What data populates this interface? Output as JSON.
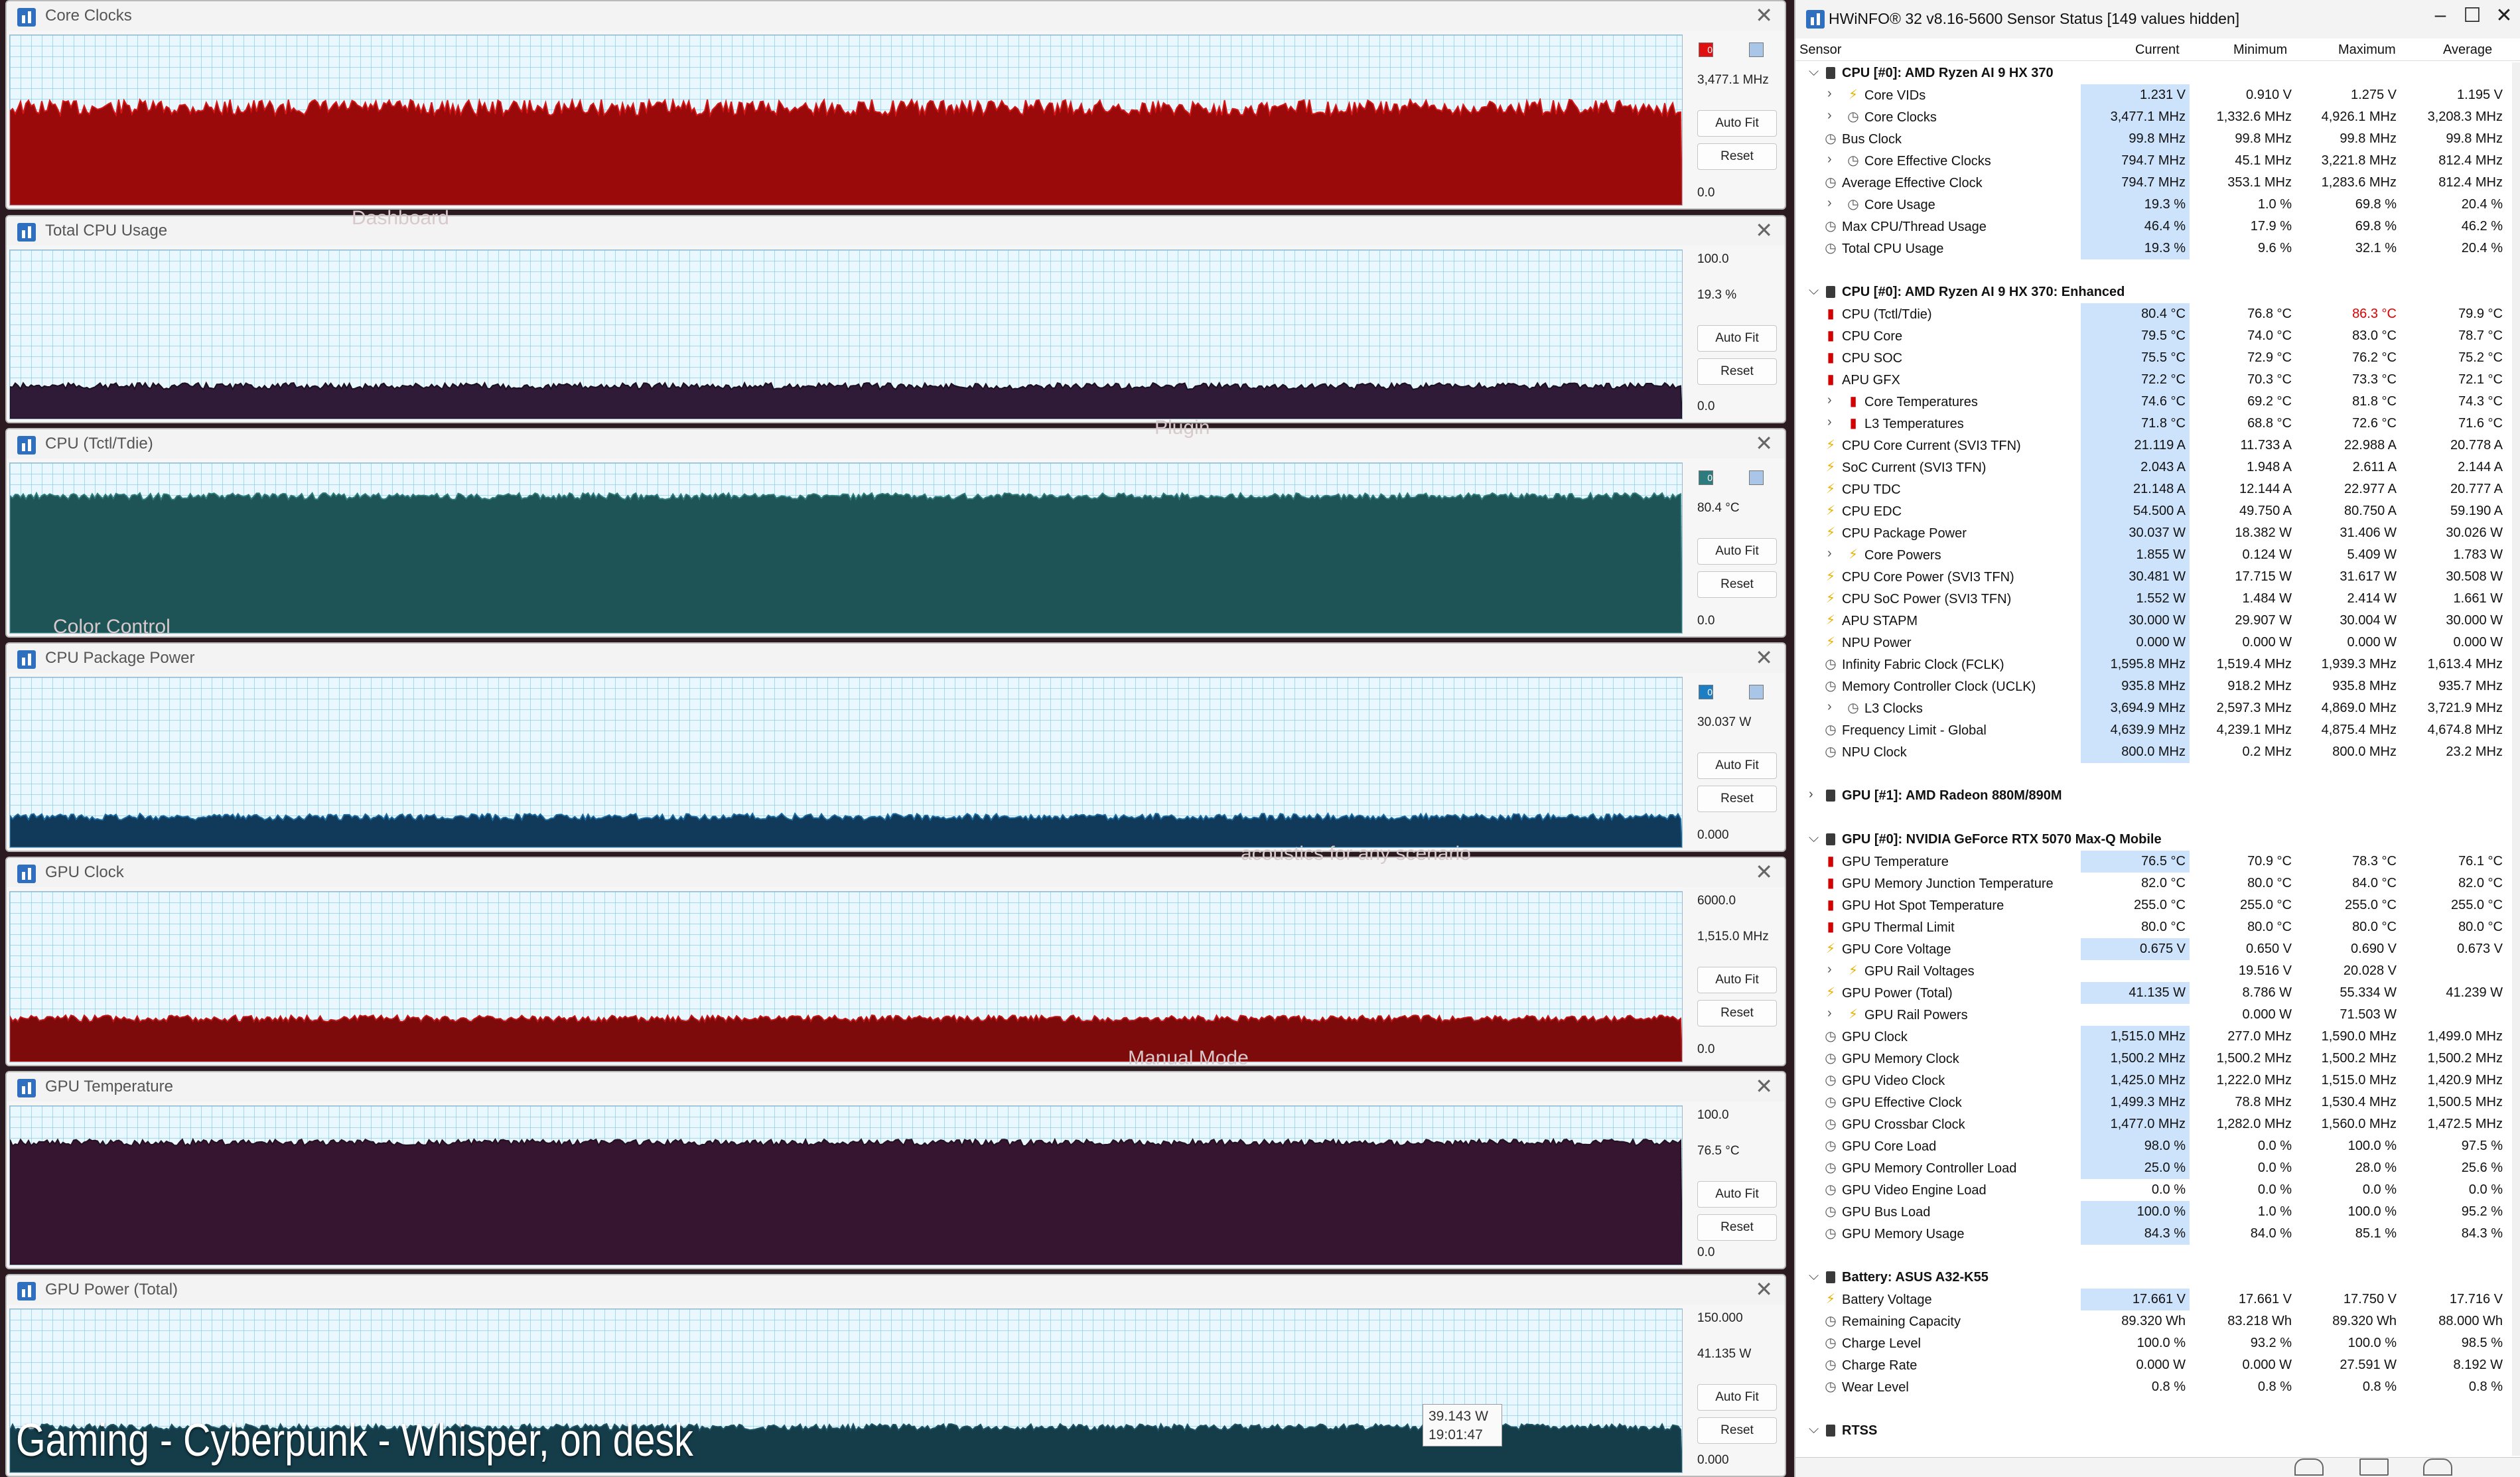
{
  "graphs": [
    {
      "title": "Core Clocks",
      "max": "",
      "current": "3,477.1 MHz",
      "min": "0.0",
      "level": 0.57,
      "fill": "#9b0a0a",
      "edge": "#d41818",
      "swatch": "#e01010",
      "swatch_text": "0",
      "auto_fit": "Auto Fit",
      "reset": "Reset"
    },
    {
      "title": "Total CPU Usage",
      "max": "100.0",
      "current": "19.3 %",
      "min": "0.0",
      "level": 0.193,
      "fill": "#2f1b37",
      "edge": "#1b0f20",
      "swatch": "",
      "swatch_text": "",
      "auto_fit": "Auto Fit",
      "reset": "Reset"
    },
    {
      "title": "CPU (Tctl/Tdie)",
      "max": "",
      "current": "80.4 °C",
      "min": "0.0",
      "level": 0.8,
      "fill": "#1f5457",
      "edge": "#2f7b7c",
      "swatch": "#2e7b7d",
      "swatch_text": "0",
      "auto_fit": "Auto Fit",
      "reset": "Reset"
    },
    {
      "title": "CPU Package Power",
      "max": "",
      "current": "30.037 W",
      "min": "0.000",
      "level": 0.18,
      "fill": "#10395a",
      "edge": "#1a6aa0",
      "swatch": "#1d7ec4",
      "swatch_text": "0",
      "auto_fit": "Auto Fit",
      "reset": "Reset"
    },
    {
      "title": "GPU Clock",
      "max": "6000.0",
      "current": "1,515.0 MHz",
      "min": "0.0",
      "level": 0.2525,
      "fill": "#7d0b0b",
      "edge": "#c41515",
      "swatch": "",
      "swatch_text": "",
      "auto_fit": "Auto Fit",
      "reset": "Reset"
    },
    {
      "title": "GPU Temperature",
      "max": "100.0",
      "current": "76.5 °C",
      "min": "0.0",
      "level": 0.765,
      "fill": "#35152f",
      "edge": "#231020",
      "swatch": "",
      "swatch_text": "",
      "auto_fit": "Auto Fit",
      "reset": "Reset"
    },
    {
      "title": "GPU Power (Total)",
      "max": "150.000",
      "current": "41.135 W",
      "min": "0.000",
      "level": 0.274,
      "fill": "#143c49",
      "edge": "#1d5566",
      "swatch": "",
      "swatch_text": "",
      "auto_fit": "Auto Fit",
      "reset": "Reset"
    }
  ],
  "caption": "Gaming - Cyberpunk - Whisper, on desk",
  "tooltip": {
    "value": "39.143 W",
    "time": "19:01:47"
  },
  "bg_words": [
    "Dashboard",
    "Plugin",
    "Color Control",
    "acoustics for any scenario",
    "Manual Mode"
  ],
  "sensor": {
    "title": "HWiNFO® 32 v8.16-5600 Sensor Status [149 values hidden]",
    "columns": {
      "sensor": "Sensor",
      "current": "Current",
      "minimum": "Minimum",
      "maximum": "Maximum",
      "average": "Average"
    },
    "rows": [
      {
        "type": "group",
        "expanded": true,
        "name": "CPU [#0]: AMD Ryzen AI 9 HX 370"
      },
      {
        "icon": "bolt",
        "indent": 1,
        "exp": true,
        "label": "Core VIDs",
        "cur": "1.231 V",
        "min": "0.910 V",
        "max": "1.275 V",
        "avg": "1.195 V",
        "hl": true
      },
      {
        "icon": "clock",
        "indent": 1,
        "exp": true,
        "label": "Core Clocks",
        "cur": "3,477.1 MHz",
        "min": "1,332.6 MHz",
        "max": "4,926.1 MHz",
        "avg": "3,208.3 MHz",
        "hl": true
      },
      {
        "icon": "clock",
        "indent": 0,
        "label": "Bus Clock",
        "cur": "99.8 MHz",
        "min": "99.8 MHz",
        "max": "99.8 MHz",
        "avg": "99.8 MHz",
        "hl": true
      },
      {
        "icon": "clock",
        "indent": 1,
        "exp": true,
        "label": "Core Effective Clocks",
        "cur": "794.7 MHz",
        "min": "45.1 MHz",
        "max": "3,221.8 MHz",
        "avg": "812.4 MHz",
        "hl": true
      },
      {
        "icon": "clock",
        "indent": 0,
        "label": "Average Effective Clock",
        "cur": "794.7 MHz",
        "min": "353.1 MHz",
        "max": "1,283.6 MHz",
        "avg": "812.4 MHz",
        "hl": true
      },
      {
        "icon": "clock",
        "indent": 1,
        "exp": true,
        "label": "Core Usage",
        "cur": "19.3 %",
        "min": "1.0 %",
        "max": "69.8 %",
        "avg": "20.4 %",
        "hl": true
      },
      {
        "icon": "clock",
        "indent": 0,
        "label": "Max CPU/Thread Usage",
        "cur": "46.4 %",
        "min": "17.9 %",
        "max": "69.8 %",
        "avg": "46.2 %",
        "hl": true
      },
      {
        "icon": "clock",
        "indent": 0,
        "label": "Total CPU Usage",
        "cur": "19.3 %",
        "min": "9.6 %",
        "max": "32.1 %",
        "avg": "20.4 %",
        "hl": true
      },
      {
        "type": "spacer"
      },
      {
        "type": "group",
        "expanded": true,
        "name": "CPU [#0]: AMD Ryzen AI 9 HX 370: Enhanced"
      },
      {
        "icon": "therm",
        "indent": 0,
        "label": "CPU (Tctl/Tdie)",
        "cur": "80.4 °C",
        "min": "76.8 °C",
        "max": "86.3 °C",
        "avg": "79.9 °C",
        "hl": true,
        "maxred": true
      },
      {
        "icon": "therm",
        "indent": 0,
        "label": "CPU Core",
        "cur": "79.5 °C",
        "min": "74.0 °C",
        "max": "83.0 °C",
        "avg": "78.7 °C",
        "hl": true
      },
      {
        "icon": "therm",
        "indent": 0,
        "label": "CPU SOC",
        "cur": "75.5 °C",
        "min": "72.9 °C",
        "max": "76.2 °C",
        "avg": "75.2 °C",
        "hl": true
      },
      {
        "icon": "therm",
        "indent": 0,
        "label": "APU GFX",
        "cur": "72.2 °C",
        "min": "70.3 °C",
        "max": "73.3 °C",
        "avg": "72.1 °C",
        "hl": true
      },
      {
        "icon": "therm",
        "indent": 1,
        "exp": true,
        "label": "Core Temperatures",
        "cur": "74.6 °C",
        "min": "69.2 °C",
        "max": "81.8 °C",
        "avg": "74.3 °C",
        "hl": true
      },
      {
        "icon": "therm",
        "indent": 1,
        "exp": true,
        "label": "L3 Temperatures",
        "cur": "71.8 °C",
        "min": "68.8 °C",
        "max": "72.6 °C",
        "avg": "71.6 °C",
        "hl": true
      },
      {
        "icon": "bolt",
        "indent": 0,
        "label": "CPU Core Current (SVI3 TFN)",
        "cur": "21.119 A",
        "min": "11.733 A",
        "max": "22.988 A",
        "avg": "20.778 A",
        "hl": true
      },
      {
        "icon": "bolt",
        "indent": 0,
        "label": "SoC Current (SVI3 TFN)",
        "cur": "2.043 A",
        "min": "1.948 A",
        "max": "2.611 A",
        "avg": "2.144 A",
        "hl": true
      },
      {
        "icon": "bolt",
        "indent": 0,
        "label": "CPU TDC",
        "cur": "21.148 A",
        "min": "12.144 A",
        "max": "22.977 A",
        "avg": "20.777 A",
        "hl": true
      },
      {
        "icon": "bolt",
        "indent": 0,
        "label": "CPU EDC",
        "cur": "54.500 A",
        "min": "49.750 A",
        "max": "80.750 A",
        "avg": "59.190 A",
        "hl": true
      },
      {
        "icon": "bolt",
        "indent": 0,
        "label": "CPU Package Power",
        "cur": "30.037 W",
        "min": "18.382 W",
        "max": "31.406 W",
        "avg": "30.026 W",
        "hl": true
      },
      {
        "icon": "bolt",
        "indent": 1,
        "exp": true,
        "label": "Core Powers",
        "cur": "1.855 W",
        "min": "0.124 W",
        "max": "5.409 W",
        "avg": "1.783 W",
        "hl": true
      },
      {
        "icon": "bolt",
        "indent": 0,
        "label": "CPU Core Power (SVI3 TFN)",
        "cur": "30.481 W",
        "min": "17.715 W",
        "max": "31.617 W",
        "avg": "30.508 W",
        "hl": true
      },
      {
        "icon": "bolt",
        "indent": 0,
        "label": "CPU SoC Power (SVI3 TFN)",
        "cur": "1.552 W",
        "min": "1.484 W",
        "max": "2.414 W",
        "avg": "1.661 W",
        "hl": true
      },
      {
        "icon": "bolt",
        "indent": 0,
        "label": "APU STAPM",
        "cur": "30.000 W",
        "min": "29.907 W",
        "max": "30.004 W",
        "avg": "30.000 W",
        "hl": true
      },
      {
        "icon": "bolt",
        "indent": 0,
        "label": "NPU Power",
        "cur": "0.000 W",
        "min": "0.000 W",
        "max": "0.000 W",
        "avg": "0.000 W",
        "hl": true
      },
      {
        "icon": "clock",
        "indent": 0,
        "label": "Infinity Fabric Clock (FCLK)",
        "cur": "1,595.8 MHz",
        "min": "1,519.4 MHz",
        "max": "1,939.3 MHz",
        "avg": "1,613.4 MHz",
        "hl": true
      },
      {
        "icon": "clock",
        "indent": 0,
        "label": "Memory Controller Clock (UCLK)",
        "cur": "935.8 MHz",
        "min": "918.2 MHz",
        "max": "935.8 MHz",
        "avg": "935.7 MHz",
        "hl": true
      },
      {
        "icon": "clock",
        "indent": 1,
        "exp": true,
        "label": "L3 Clocks",
        "cur": "3,694.9 MHz",
        "min": "2,597.3 MHz",
        "max": "4,869.0 MHz",
        "avg": "3,721.9 MHz",
        "hl": true
      },
      {
        "icon": "clock",
        "indent": 0,
        "label": "Frequency Limit - Global",
        "cur": "4,639.9 MHz",
        "min": "4,239.1 MHz",
        "max": "4,875.4 MHz",
        "avg": "4,674.8 MHz",
        "hl": true
      },
      {
        "icon": "clock",
        "indent": 0,
        "label": "NPU Clock",
        "cur": "800.0 MHz",
        "min": "0.2 MHz",
        "max": "800.0 MHz",
        "avg": "23.2 MHz",
        "hl": true
      },
      {
        "type": "spacer"
      },
      {
        "type": "group",
        "expanded": false,
        "name": "GPU [#1]: AMD Radeon 880M/890M"
      },
      {
        "type": "spacer"
      },
      {
        "type": "group",
        "expanded": true,
        "name": "GPU [#0]: NVIDIA  GeForce RTX 5070 Max-Q Mobile"
      },
      {
        "icon": "therm",
        "indent": 0,
        "label": "GPU Temperature",
        "cur": "76.5 °C",
        "min": "70.9 °C",
        "max": "78.3 °C",
        "avg": "76.1 °C",
        "hl": true
      },
      {
        "icon": "therm",
        "indent": 0,
        "label": "GPU Memory Junction Temperature",
        "cur": "82.0 °C",
        "min": "80.0 °C",
        "max": "84.0 °C",
        "avg": "82.0 °C",
        "hl": false
      },
      {
        "icon": "therm",
        "indent": 0,
        "label": "GPU Hot Spot Temperature",
        "cur": "255.0 °C",
        "min": "255.0 °C",
        "max": "255.0 °C",
        "avg": "255.0 °C",
        "hl": false
      },
      {
        "icon": "therm",
        "indent": 0,
        "label": "GPU Thermal Limit",
        "cur": "80.0 °C",
        "min": "80.0 °C",
        "max": "80.0 °C",
        "avg": "80.0 °C",
        "hl": false
      },
      {
        "icon": "bolt",
        "indent": 0,
        "label": "GPU Core Voltage",
        "cur": "0.675 V",
        "min": "0.650 V",
        "max": "0.690 V",
        "avg": "0.673 V",
        "hl": true
      },
      {
        "icon": "bolt",
        "indent": 1,
        "exp": true,
        "label": "GPU Rail Voltages",
        "cur": "",
        "min": "19.516 V",
        "max": "20.028 V",
        "avg": "",
        "hl": false
      },
      {
        "icon": "bolt",
        "indent": 0,
        "label": "GPU Power (Total)",
        "cur": "41.135 W",
        "min": "8.786 W",
        "max": "55.334 W",
        "avg": "41.239 W",
        "hl": true
      },
      {
        "icon": "bolt",
        "indent": 1,
        "exp": true,
        "label": "GPU Rail Powers",
        "cur": "",
        "min": "0.000 W",
        "max": "71.503 W",
        "avg": "",
        "hl": false
      },
      {
        "icon": "clock",
        "indent": 0,
        "label": "GPU Clock",
        "cur": "1,515.0 MHz",
        "min": "277.0 MHz",
        "max": "1,590.0 MHz",
        "avg": "1,499.0 MHz",
        "hl": true
      },
      {
        "icon": "clock",
        "indent": 0,
        "label": "GPU Memory Clock",
        "cur": "1,500.2 MHz",
        "min": "1,500.2 MHz",
        "max": "1,500.2 MHz",
        "avg": "1,500.2 MHz",
        "hl": true
      },
      {
        "icon": "clock",
        "indent": 0,
        "label": "GPU Video Clock",
        "cur": "1,425.0 MHz",
        "min": "1,222.0 MHz",
        "max": "1,515.0 MHz",
        "avg": "1,420.9 MHz",
        "hl": true
      },
      {
        "icon": "clock",
        "indent": 0,
        "label": "GPU Effective Clock",
        "cur": "1,499.3 MHz",
        "min": "78.8 MHz",
        "max": "1,530.4 MHz",
        "avg": "1,500.5 MHz",
        "hl": true
      },
      {
        "icon": "clock",
        "indent": 0,
        "label": "GPU Crossbar Clock",
        "cur": "1,477.0 MHz",
        "min": "1,282.0 MHz",
        "max": "1,560.0 MHz",
        "avg": "1,472.5 MHz",
        "hl": true
      },
      {
        "icon": "clock",
        "indent": 0,
        "label": "GPU Core Load",
        "cur": "98.0 %",
        "min": "0.0 %",
        "max": "100.0 %",
        "avg": "97.5 %",
        "hl": true
      },
      {
        "icon": "clock",
        "indent": 0,
        "label": "GPU Memory Controller Load",
        "cur": "25.0 %",
        "min": "0.0 %",
        "max": "28.0 %",
        "avg": "25.6 %",
        "hl": true
      },
      {
        "icon": "clock",
        "indent": 0,
        "label": "GPU Video Engine Load",
        "cur": "0.0 %",
        "min": "0.0 %",
        "max": "0.0 %",
        "avg": "0.0 %",
        "hl": false
      },
      {
        "icon": "clock",
        "indent": 0,
        "label": "GPU Bus Load",
        "cur": "100.0 %",
        "min": "1.0 %",
        "max": "100.0 %",
        "avg": "95.2 %",
        "hl": true
      },
      {
        "icon": "clock",
        "indent": 0,
        "label": "GPU Memory Usage",
        "cur": "84.3 %",
        "min": "84.0 %",
        "max": "85.1 %",
        "avg": "84.3 %",
        "hl": true
      },
      {
        "type": "spacer"
      },
      {
        "type": "group",
        "expanded": true,
        "name": "Battery: ASUS  A32-K55"
      },
      {
        "icon": "bolt",
        "indent": 0,
        "label": "Battery Voltage",
        "cur": "17.661 V",
        "min": "17.661 V",
        "max": "17.750 V",
        "avg": "17.716 V",
        "hl": true
      },
      {
        "icon": "clock",
        "indent": 0,
        "label": "Remaining Capacity",
        "cur": "89.320 Wh",
        "min": "83.218 Wh",
        "max": "89.320 Wh",
        "avg": "88.000 Wh",
        "hl": false
      },
      {
        "icon": "clock",
        "indent": 0,
        "label": "Charge Level",
        "cur": "100.0 %",
        "min": "93.2 %",
        "max": "100.0 %",
        "avg": "98.5 %",
        "hl": false
      },
      {
        "icon": "clock",
        "indent": 0,
        "label": "Charge Rate",
        "cur": "0.000 W",
        "min": "0.000 W",
        "max": "27.591 W",
        "avg": "8.192 W",
        "hl": false
      },
      {
        "icon": "clock",
        "indent": 0,
        "label": "Wear Level",
        "cur": "0.8 %",
        "min": "0.8 %",
        "max": "0.8 %",
        "avg": "0.8 %",
        "hl": false
      },
      {
        "type": "spacer"
      },
      {
        "type": "group",
        "expanded": true,
        "name": "RTSS"
      }
    ]
  }
}
